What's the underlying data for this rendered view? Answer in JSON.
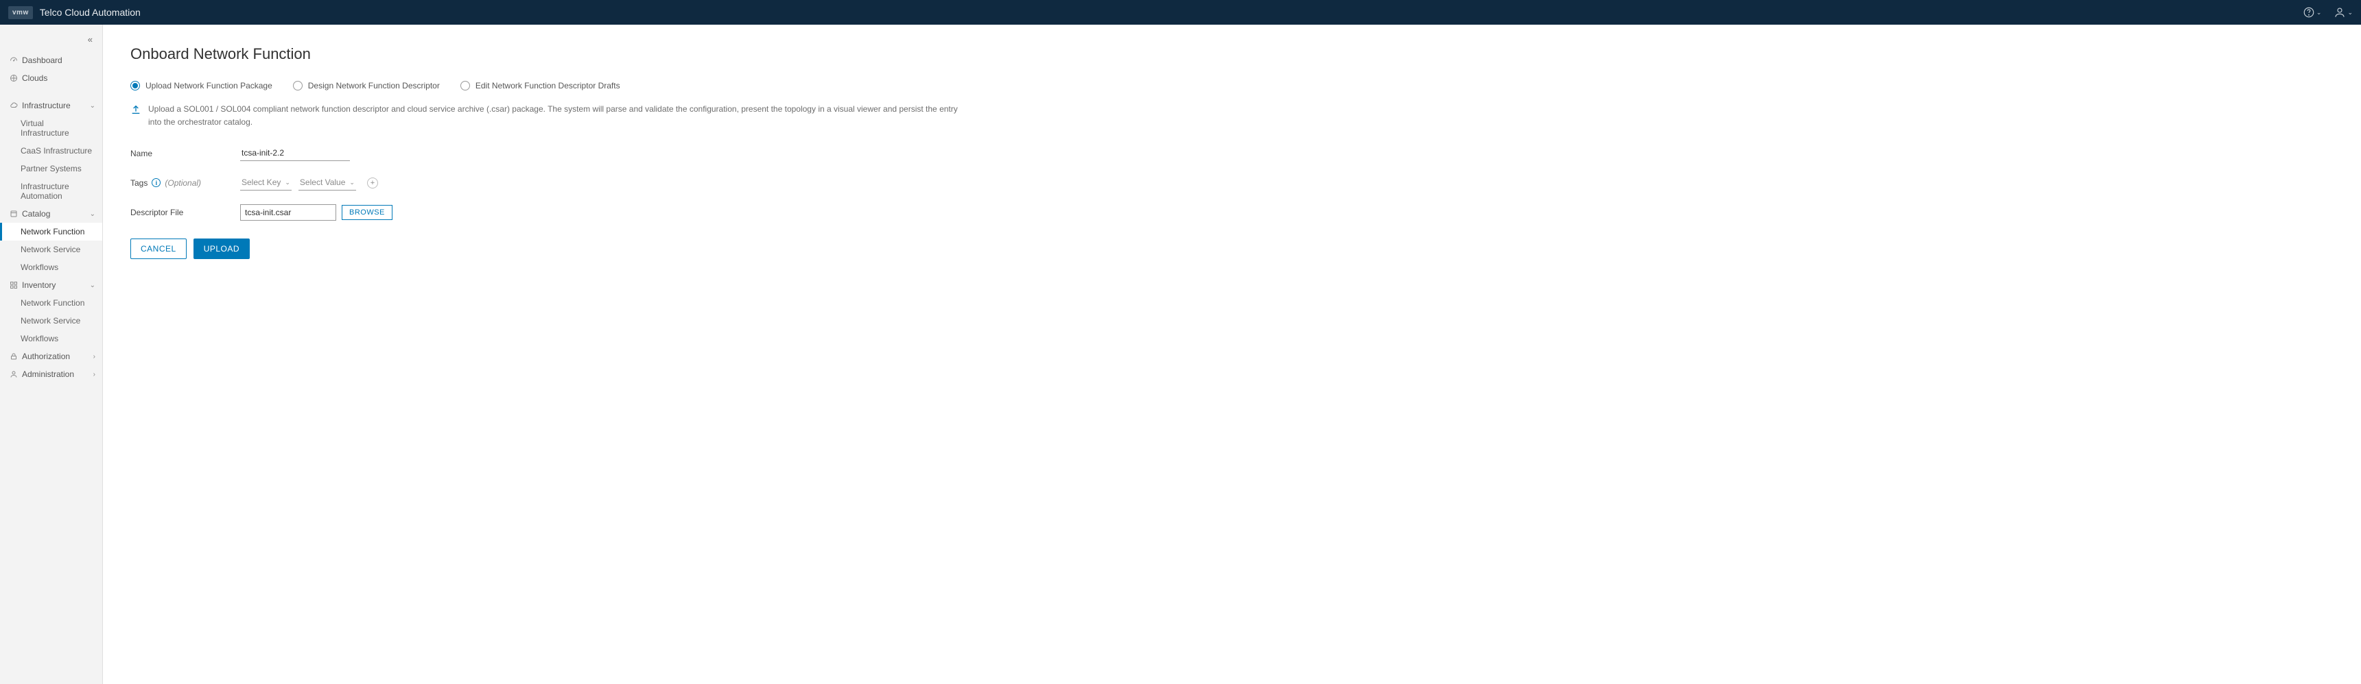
{
  "header": {
    "brand": "vmw",
    "title": "Telco Cloud Automation"
  },
  "sidebar": {
    "dashboard": "Dashboard",
    "clouds": "Clouds",
    "infrastructure": {
      "label": "Infrastructure",
      "virtual": "Virtual Infrastructure",
      "caas": "CaaS Infrastructure",
      "partner": "Partner Systems",
      "automation": "Infrastructure Automation"
    },
    "catalog": {
      "label": "Catalog",
      "nf": "Network Function",
      "ns": "Network Service",
      "wf": "Workflows"
    },
    "inventory": {
      "label": "Inventory",
      "nf": "Network Function",
      "ns": "Network Service",
      "wf": "Workflows"
    },
    "authorization": "Authorization",
    "administration": "Administration"
  },
  "page": {
    "title": "Onboard Network Function",
    "radios": {
      "upload": "Upload Network Function Package",
      "design": "Design Network Function Descriptor",
      "edit": "Edit Network Function Descriptor Drafts"
    },
    "info": "Upload a SOL001 / SOL004 compliant network function descriptor and cloud service archive (.csar) package. The system will parse and validate the configuration, present the topology in a visual viewer and persist the entry into the orchestrator catalog.",
    "fields": {
      "name_label": "Name",
      "name_value": "tcsa-init-2.2",
      "tags_label": "Tags",
      "tags_optional": "(Optional)",
      "select_key": "Select Key",
      "select_value": "Select Value",
      "descriptor_label": "Descriptor File",
      "descriptor_value": "tcsa-init.csar",
      "browse": "BROWSE"
    },
    "actions": {
      "cancel": "CANCEL",
      "upload": "UPLOAD"
    }
  }
}
